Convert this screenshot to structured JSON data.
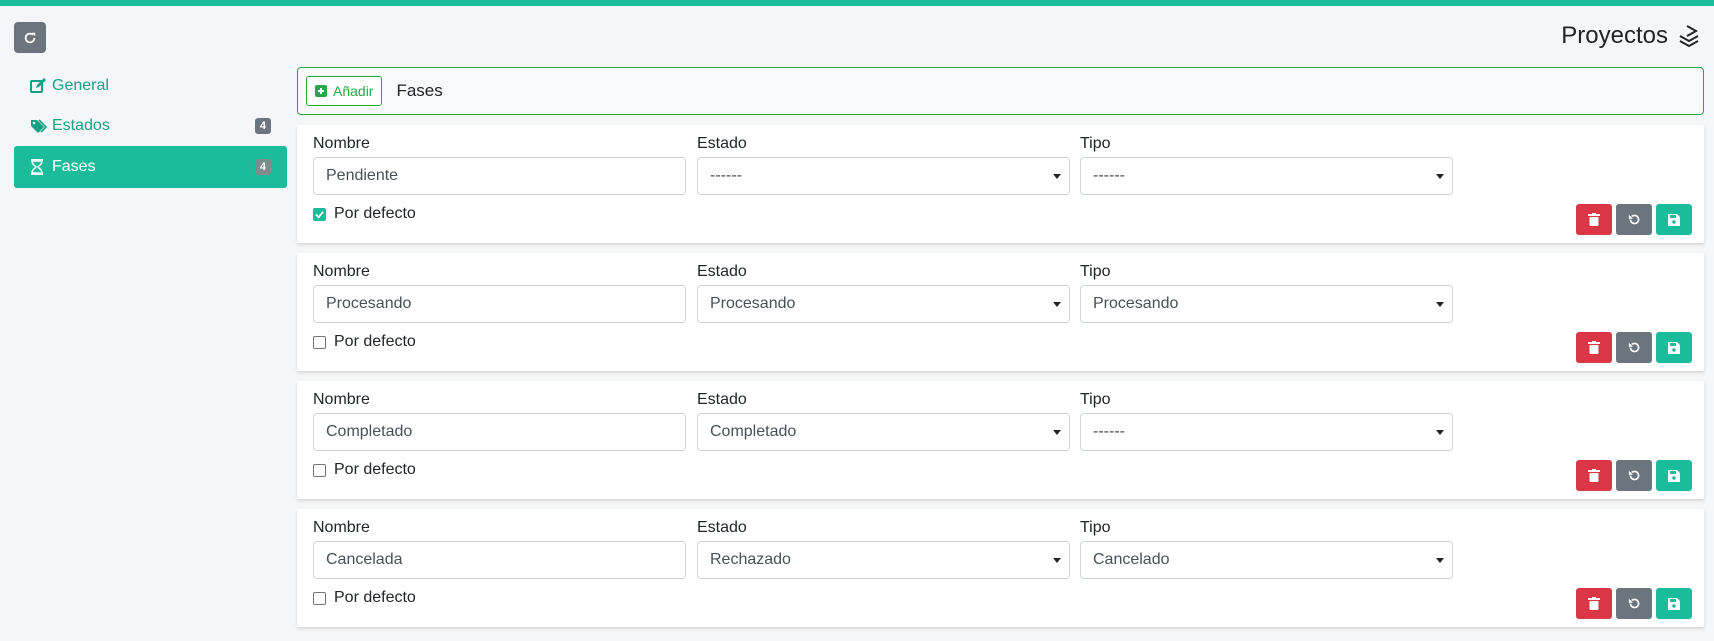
{
  "colors": {
    "accent": "#1abc9c",
    "success": "#28a745",
    "danger": "#dc3545",
    "secondary": "#6c757d"
  },
  "header": {
    "title": "Proyectos",
    "refresh_icon": "refresh-icon",
    "title_icon": "stack-icon"
  },
  "sidebar": {
    "items": [
      {
        "label": "General",
        "icon": "edit-icon",
        "badge": ""
      },
      {
        "label": "Estados",
        "icon": "tags-icon",
        "badge": "4"
      },
      {
        "label": "Fases",
        "icon": "hourglass-icon",
        "badge": "4",
        "active": true
      }
    ]
  },
  "toolbar": {
    "add_label": "Añadir",
    "section_label": "Fases"
  },
  "form_labels": {
    "name": "Nombre",
    "state": "Estado",
    "type": "Tipo",
    "default": "Por defecto"
  },
  "phases": [
    {
      "name": "Pendiente",
      "state": "------",
      "type": "------",
      "default": true
    },
    {
      "name": "Procesando",
      "state": "Procesando",
      "type": "Procesando",
      "default": false
    },
    {
      "name": "Completado",
      "state": "Completado",
      "type": "------",
      "default": false
    },
    {
      "name": "Cancelada",
      "state": "Rechazado",
      "type": "Cancelado",
      "default": false
    }
  ]
}
